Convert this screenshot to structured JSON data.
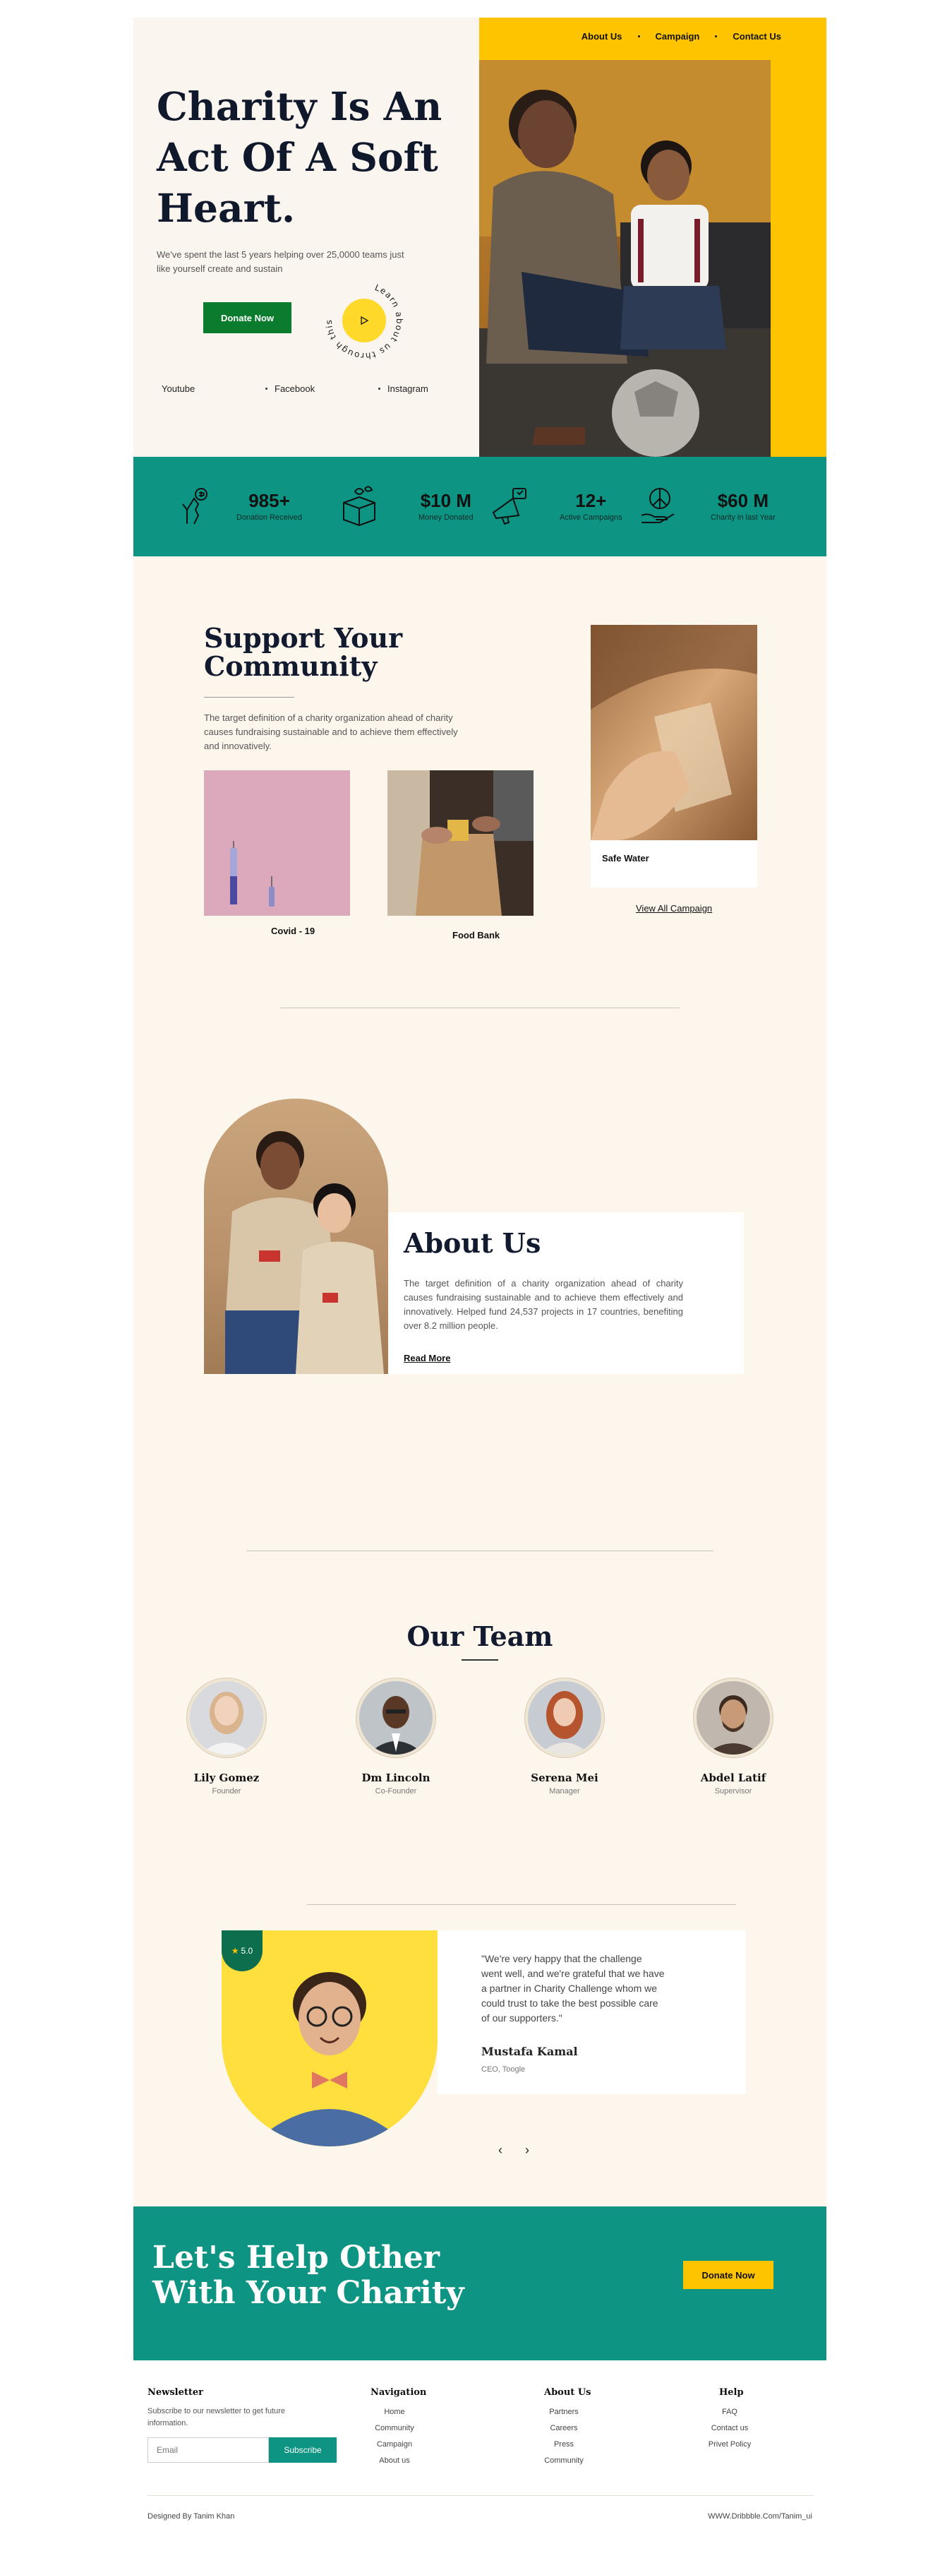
{
  "nav": {
    "items": [
      "About Us",
      "Campaign",
      "Contact Us"
    ]
  },
  "hero": {
    "title": "Charity Is An Act Of A Soft Heart.",
    "description": "We've spent the last 5 years helping over 25,0000 teams just like yourself create and sustain",
    "donate_label": "Donate Now",
    "video_text": "Learn about us through this video",
    "socials": [
      "Youtube",
      "Facebook",
      "Instagram"
    ]
  },
  "stats": [
    {
      "value": "985+",
      "label": "Donation Received",
      "icon": "donation-hand-icon"
    },
    {
      "value": "$10 M",
      "label": "Money Donated",
      "icon": "gift-box-icon"
    },
    {
      "value": "12+",
      "label": "Active Campaigns",
      "icon": "megaphone-icon"
    },
    {
      "value": "$60 M",
      "label": "Charity in last Year",
      "icon": "peace-hand-icon"
    }
  ],
  "support": {
    "title": "Support Your Community",
    "description": "The target definition of a charity organization ahead of charity causes fundraising sustainable and to achieve them effectively and innovatively.",
    "cards": [
      "Covid - 19",
      "Food Bank",
      "Safe Water"
    ],
    "view_all": "View All Campaign"
  },
  "about": {
    "title": "About Us",
    "description": "The target definition of a charity organization ahead of charity causes fundraising sustainable and to achieve them effectively and innovatively. Helped fund 24,537 projects in 17 countries, benefiting over 8.2 million people.",
    "read_more": "Read More"
  },
  "team": {
    "title": "Our Team",
    "members": [
      {
        "name": "Lily Gomez",
        "role": "Founder"
      },
      {
        "name": "Dm Lincoln",
        "role": "Co-Founder"
      },
      {
        "name": "Serena Mei",
        "role": "Manager"
      },
      {
        "name": "Abdel Latif",
        "role": "Supervisor"
      }
    ]
  },
  "testimonial": {
    "rating": "5.0",
    "quote": "\"We're very happy that the challenge went well, and we're grateful that we have a partner in Charity Challenge whom we could trust to take the best possible care of our supporters.\"",
    "name": "Mustafa Kamal",
    "role": "CEO, Toogle"
  },
  "cta": {
    "title": "Let's Help Other With Your Charity",
    "button": "Donate Now"
  },
  "footer": {
    "newsletter": {
      "heading": "Newsletter",
      "text": "Subscribe to our newsletter to get future information.",
      "placeholder": "Email",
      "button": "Subscribe"
    },
    "navigation": {
      "heading": "Navigation",
      "items": [
        "Home",
        "Community",
        "Campaign",
        "About us"
      ]
    },
    "about": {
      "heading": "About Us",
      "items": [
        "Partners",
        "Careers",
        "Press",
        "Community"
      ]
    },
    "help": {
      "heading": "Help",
      "items": [
        "FAQ",
        "Contact us",
        "Privet Policy"
      ]
    },
    "credit": "Designed By Tanim Khan",
    "url": "WWW.Dribbble.Com/Tanim_ui"
  },
  "colors": {
    "teal": "#0d9482",
    "yellow": "#ffc400",
    "green": "#0b7b2e",
    "cream": "#fdf6ec"
  }
}
